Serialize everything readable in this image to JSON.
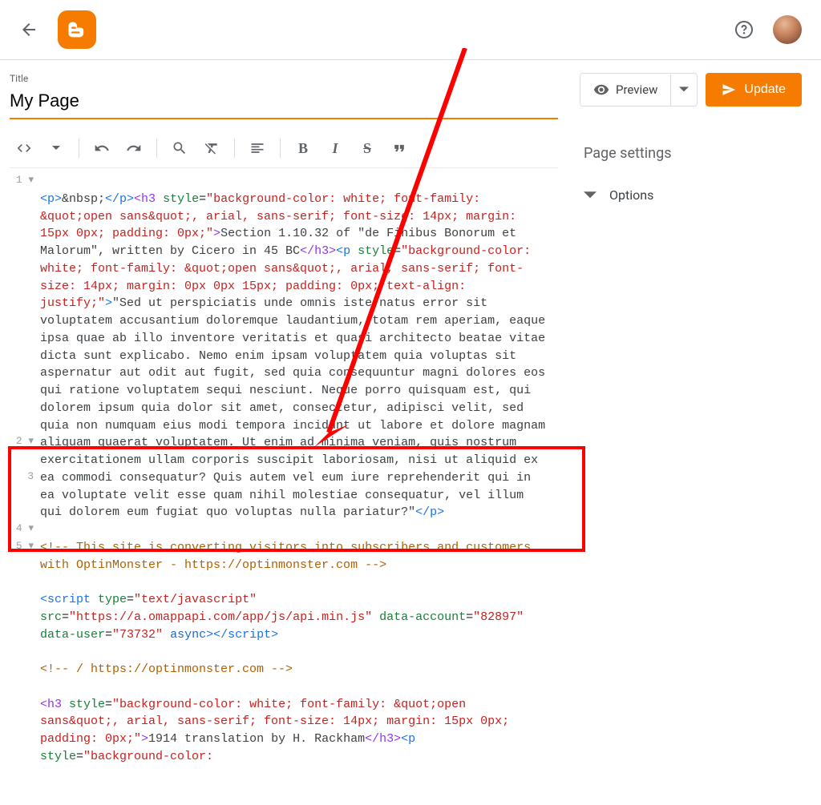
{
  "header": {
    "back_label": "Back",
    "help_label": "Help"
  },
  "title_field": {
    "label": "Title",
    "value": "My Page"
  },
  "actions": {
    "preview_label": "Preview",
    "update_label": "Update"
  },
  "settings": {
    "heading": "Page settings",
    "options_label": "Options"
  },
  "editor_gutter": [
    "1 ▾",
    "",
    "",
    "",
    "",
    "",
    "",
    "",
    "",
    "",
    "",
    "",
    "",
    "",
    "",
    "2 ▾",
    "",
    "3",
    "",
    "",
    "4 ▾",
    "5 ▾",
    "",
    ""
  ],
  "code": {
    "line1": {
      "h3_open": "<h3 ",
      "p_open": "<p>",
      "nbsp": "&nbsp;",
      "p_close": "</p>",
      "style_attr": "style",
      "eq": "=",
      "style_val_a": "\"background-color: white; font-family: &quot;open sans&quot;, arial, sans-serif; font-size: 14px; margin: 15px 0px; padding: 0px;\"",
      "gt": ">",
      "h3_text": "Section 1.10.32 of \"de Finibus Bonorum et Malorum\", written by Cicero in 45 BC",
      "h3_close": "</h3>",
      "p2_open": "<p ",
      "style_val_b": "\"background-color: white; font-family: &quot;open sans&quot;, arial, sans-serif; font-size: 14px; margin: 0px 0px 15px; padding: 0px; text-align: justify;\"",
      "para_text": "\"Sed ut perspiciatis unde omnis iste natus error sit voluptatem accusantium doloremque laudantium, totam rem aperiam, eaque ipsa quae ab illo inventore veritatis et quasi architecto beatae vitae dicta sunt explicabo. Nemo enim ipsam voluptatem quia voluptas sit aspernatur aut odit aut fugit, sed quia consequuntur magni dolores eos qui ratione voluptatem sequi nesciunt. Neque porro quisquam est, qui dolorem ipsum quia dolor sit amet, consectetur, adipisci velit, sed quia non numquam eius modi tempora incidunt ut labore et dolore magnam aliquam quaerat voluptatem. Ut enim ad minima veniam, quis nostrum exercitationem ullam corporis suscipit laboriosam, nisi ut aliquid ex ea commodi consequatur? Quis autem vel eum iure reprehenderit qui in ea voluptate velit esse quam nihil molestiae consequatur, vel illum qui dolorem eum fugiat quo voluptas nulla pariatur?\"",
      "p2_close": "</p>"
    },
    "line2": {
      "comment": "<!-- This site is converting visitors into subscribers and customers with OptinMonster - https://optinmonster.com -->"
    },
    "line3": {
      "script_open": "<script ",
      "type_attr": "type",
      "type_val": "\"text/javascript\"",
      "src_attr": "src",
      "src_val": "\"https://a.omappapi.com/app/js/api.min.js\"",
      "da_attr": "data-account",
      "da_val": "\"82897\"",
      "du_attr": "data-user",
      "du_val": "\"73732\"",
      "async": "async",
      "gt": ">",
      "script_close": "</script>"
    },
    "line4": {
      "comment": "<!-- / https://optinmonster.com -->"
    },
    "line5": {
      "h3_open": "<h3 ",
      "style_attr": "style",
      "style_val": "\"background-color: white; font-family: &quot;open sans&quot;, arial, sans-serif; font-size: 14px; margin: 15px 0px; padding: 0px;\"",
      "gt": ">",
      "h3_text": "1914 translation by H. Rackham",
      "h3_close": "</h3>",
      "p_open": "<p ",
      "style_val2": "\"background-color:"
    }
  }
}
